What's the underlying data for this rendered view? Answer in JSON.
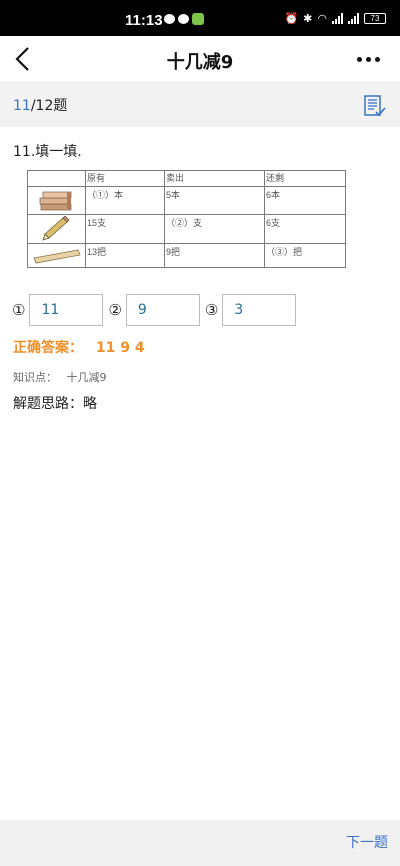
{
  "status_bar": {
    "time": "11:13",
    "battery": "73"
  },
  "header": {
    "title": "十几减9"
  },
  "progress": {
    "current": "11",
    "total_suffix": "/12题"
  },
  "question": {
    "title": "11.填一填.",
    "table": {
      "headers": [
        "原有",
        "卖出",
        "还剩"
      ],
      "rows": [
        {
          "item_icon": "books-icon",
          "cells": [
            "（①）本",
            "5本",
            "6本"
          ]
        },
        {
          "item_icon": "pencil-icon",
          "cells": [
            "15支",
            "（②）支",
            "6支"
          ]
        },
        {
          "item_icon": "ruler-icon",
          "cells": [
            "13把",
            "9把",
            "（③）把"
          ]
        }
      ]
    }
  },
  "answers": [
    {
      "num": "①",
      "value": "11"
    },
    {
      "num": "②",
      "value": "9"
    },
    {
      "num": "③",
      "value": "3"
    }
  ],
  "correct_answer": {
    "label": "正确答案：",
    "value": "11 9 4"
  },
  "knowledge": {
    "label": "知识点：",
    "value": "十几减9"
  },
  "solution": {
    "label": "解题思路：",
    "value": "略"
  },
  "footer": {
    "next_label": "下一题"
  },
  "colors": {
    "accent": "#3b73c6",
    "answer_orange": "#f0912b"
  }
}
